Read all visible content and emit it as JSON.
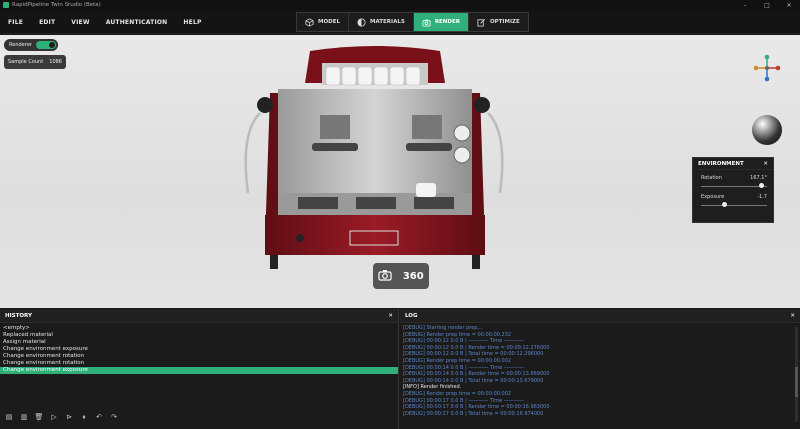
{
  "window": {
    "title": "RapidPipeline Twin Studio (Beta)",
    "controls": [
      "–",
      "□",
      "✕"
    ]
  },
  "menu": {
    "items": [
      "FILE",
      "EDIT",
      "VIEW",
      "AUTHENTICATION",
      "HELP"
    ]
  },
  "modes": [
    {
      "label": "MODEL",
      "icon": "cube-icon",
      "active": false
    },
    {
      "label": "MATERIALS",
      "icon": "materials-icon",
      "active": false
    },
    {
      "label": "RENDER",
      "icon": "camera-icon",
      "active": true
    },
    {
      "label": "OPTIMIZE",
      "icon": "edit-icon",
      "active": false
    }
  ],
  "viewport": {
    "renderer_label": "Renderer",
    "renderer_on": true,
    "sample_count_label": "Sample Count",
    "sample_count_value": "1086",
    "camera_buttons": [
      "camera-icon",
      "360-icon"
    ],
    "camera_360_label": "360"
  },
  "environment": {
    "title": "ENVIRONMENT",
    "close": "✕",
    "rotation_label": "Rotation",
    "rotation_value": "167.1°",
    "rotation_fraction": 0.92,
    "exposure_label": "Exposure",
    "exposure_value": "-1.7",
    "exposure_fraction": 0.35
  },
  "history": {
    "title": "HISTORY",
    "close": "✕",
    "items": [
      "<empty>",
      "Replaced material",
      "Assign material",
      "Change environment exposure",
      "Change environment rotation",
      "Change environment rotation",
      "Change environment exposure"
    ],
    "selected_index": 6
  },
  "log": {
    "title": "LOG",
    "close": "✕",
    "lines": [
      {
        "text": "[DEBUG] Starting render prep...",
        "level": "debug"
      },
      {
        "text": "[DEBUG] Render prep time = 00:00:00.232",
        "level": "debug"
      },
      {
        "text": "[DEBUG] 00:00:12 0.0 B | ———— Time ————",
        "level": "debug"
      },
      {
        "text": "[DEBUG] 00:00:12 0.0 B | Render time = 00:00:12.276000",
        "level": "debug"
      },
      {
        "text": "[DEBUG] 00:00:12 0.0 B | Total time = 00:00:12.296000",
        "level": "debug"
      },
      {
        "text": "[DEBUG] Render prep time = 00:00:00.002",
        "level": "debug"
      },
      {
        "text": "[DEBUG] 00:00:14 0.0 B | ———— Time ————",
        "level": "debug"
      },
      {
        "text": "[DEBUG] 00:00:14 0.0 B | Render time = 00:00:13.669000",
        "level": "debug"
      },
      {
        "text": "[DEBUG] 00:00:14 0.0 B | Total time = 00:00:13.679000",
        "level": "debug"
      },
      {
        "text": "[INFO] Render finished.",
        "level": "info"
      },
      {
        "text": "[DEBUG] Render prep time = 00:00:00.002",
        "level": "debug"
      },
      {
        "text": "[DEBUG] 00:00:17 0.0 B | ———— Time ————",
        "level": "debug"
      },
      {
        "text": "[DEBUG] 00:00:17 0.0 B | Render time = 00:00:16.963000",
        "level": "debug"
      },
      {
        "text": "[DEBUG] 00:00:17 0.0 B | Total time = 00:00:16.974000",
        "level": "debug"
      }
    ]
  },
  "colors": {
    "accent": "#2fb07a",
    "machine_body": "#8b1520",
    "debug_text": "#5a86c9"
  }
}
